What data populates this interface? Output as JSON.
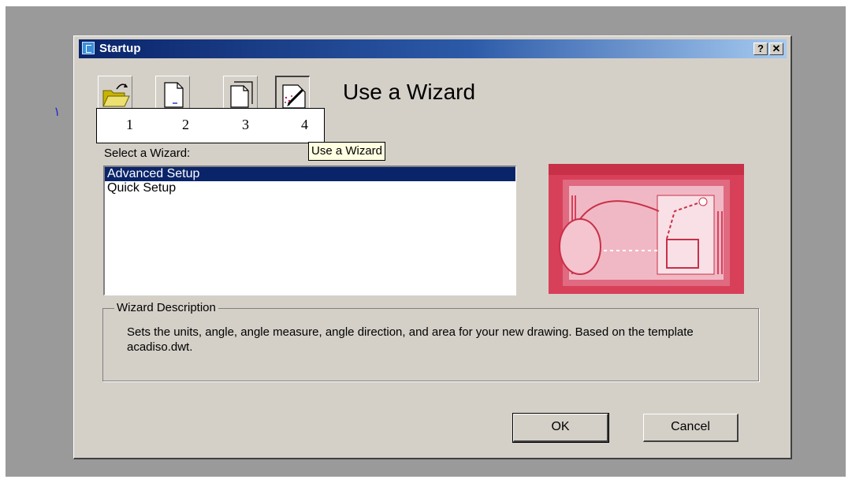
{
  "side_mark": "١",
  "window": {
    "title": "Startup",
    "help_label": "?",
    "close_label": "✕"
  },
  "mode_buttons": [
    {
      "name": "open-drawing",
      "icon": "open-folder-icon"
    },
    {
      "name": "start-from-scratch",
      "icon": "blank-page-icon"
    },
    {
      "name": "use-template",
      "icon": "template-page-icon"
    },
    {
      "name": "use-wizard",
      "icon": "wizard-pencil-icon",
      "pressed": true
    }
  ],
  "mode_title": "Use a Wizard",
  "number_overlay": [
    "1",
    "2",
    "3",
    "4"
  ],
  "tooltip": "Use a Wizard",
  "select_label": "Select a Wizard:",
  "wizard_list": {
    "items": [
      "Advanced Setup",
      "Quick Setup"
    ],
    "selected_index": 0
  },
  "description": {
    "legend": "Wizard Description",
    "text": "Sets the units, angle, angle measure, angle direction, and area for your new drawing. Based on the template acadiso.dwt."
  },
  "buttons": {
    "ok": "OK",
    "cancel": "Cancel"
  },
  "colors": {
    "selection": "#0a246a",
    "titlebar_start": "#0a246a",
    "titlebar_end": "#a6caf0",
    "preview_accent": "#d8405a"
  }
}
